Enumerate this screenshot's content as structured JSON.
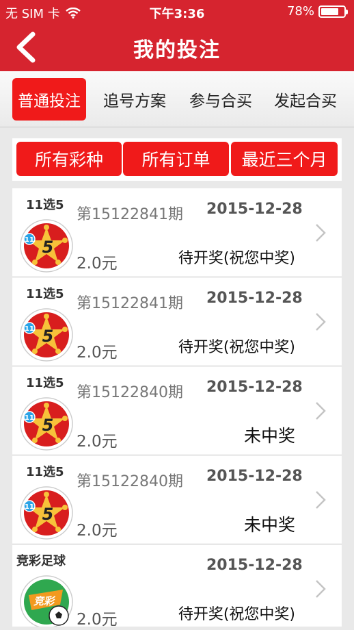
{
  "status_bar": {
    "carrier": "无 SIM 卡",
    "time": "下午3:36",
    "battery": "78%",
    "battery_level": 0.78
  },
  "nav": {
    "title": "我的投注"
  },
  "tabs": [
    {
      "label": "普通投注",
      "active": true
    },
    {
      "label": "追号方案",
      "active": false
    },
    {
      "label": "参与合买",
      "active": false
    },
    {
      "label": "发起合买",
      "active": false
    }
  ],
  "filters": [
    "所有彩种",
    "所有订单",
    "最近三个月"
  ],
  "orders": [
    {
      "game": "11选5",
      "issue": "第15122841期",
      "date": "2015-12-28",
      "amount": "2.0元",
      "status": "待开奖(祝您中奖)",
      "icon": "11x5-logo-icon"
    },
    {
      "game": "11选5",
      "issue": "第15122841期",
      "date": "2015-12-28",
      "amount": "2.0元",
      "status": "待开奖(祝您中奖)",
      "icon": "11x5-logo-icon"
    },
    {
      "game": "11选5",
      "issue": "第15122840期",
      "date": "2015-12-28",
      "amount": "2.0元",
      "status": "未中奖",
      "icon": "11x5-logo-icon"
    },
    {
      "game": "11选5",
      "issue": "第15122840期",
      "date": "2015-12-28",
      "amount": "2.0元",
      "status": "未中奖",
      "icon": "11x5-logo-icon"
    },
    {
      "game": "竞彩足球",
      "issue": "",
      "date": "2015-12-28",
      "amount": "2.0元",
      "status": "待开奖(祝您中奖)",
      "icon": "jingcai-football-logo-icon"
    }
  ],
  "logo_text": {
    "eleven": "11",
    "five": "5",
    "jingcai": "竞彩"
  },
  "colors": {
    "brand_red": "#d6242f",
    "button_red": "#f01a1a"
  }
}
